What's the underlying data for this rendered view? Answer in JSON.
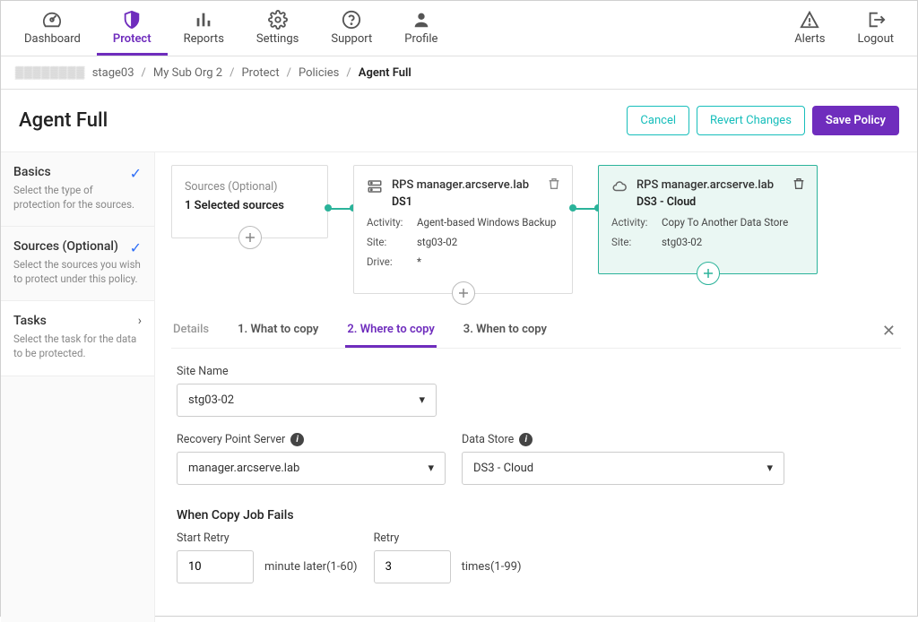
{
  "nav": {
    "dashboard": "Dashboard",
    "protect": "Protect",
    "reports": "Reports",
    "settings": "Settings",
    "support": "Support",
    "profile": "Profile",
    "alerts": "Alerts",
    "logout": "Logout"
  },
  "breadcrumb": {
    "org": "stage03",
    "suborg": "My Sub Org 2",
    "protect": "Protect",
    "policies": "Policies",
    "current": "Agent Full"
  },
  "page": {
    "title": "Agent Full",
    "cancel": "Cancel",
    "revert": "Revert Changes",
    "save": "Save Policy"
  },
  "sidebar": {
    "basics": {
      "title": "Basics",
      "desc": "Select the type of protection for the sources."
    },
    "sources": {
      "title": "Sources (Optional)",
      "desc": "Select the sources you wish to protect under this policy."
    },
    "tasks": {
      "title": "Tasks",
      "desc": "Select the task for the data to be protected."
    }
  },
  "cards": {
    "sources": {
      "label": "Sources (Optional)",
      "count": "1 Selected sources"
    },
    "node1": {
      "title": "RPS manager.arcserve.lab",
      "sub": "DS1",
      "activity_k": "Activity:",
      "activity_v": "Agent-based Windows Backup",
      "site_k": "Site:",
      "site_v": "stg03-02",
      "drive_k": "Drive:",
      "drive_v": "*"
    },
    "node2": {
      "title": "RPS manager.arcserve.lab",
      "sub": "DS3 - Cloud",
      "activity_k": "Activity:",
      "activity_v": "Copy To Another Data Store",
      "site_k": "Site:",
      "site_v": "stg03-02"
    }
  },
  "tabs": {
    "details": "Details",
    "t1": "1. What to copy",
    "t2": "2. Where to copy",
    "t3": "3. When to copy"
  },
  "form": {
    "site_label": "Site Name",
    "site_value": "stg03-02",
    "rps_label": "Recovery Point Server",
    "rps_value": "manager.arcserve.lab",
    "ds_label": "Data Store",
    "ds_value": "DS3 - Cloud",
    "fail_h": "When Copy Job Fails",
    "start_retry_label": "Start Retry",
    "start_retry_value": "10",
    "start_retry_suffix": "minute later(1-60)",
    "retry_label": "Retry",
    "retry_value": "3",
    "retry_suffix": "times(1-99)"
  }
}
